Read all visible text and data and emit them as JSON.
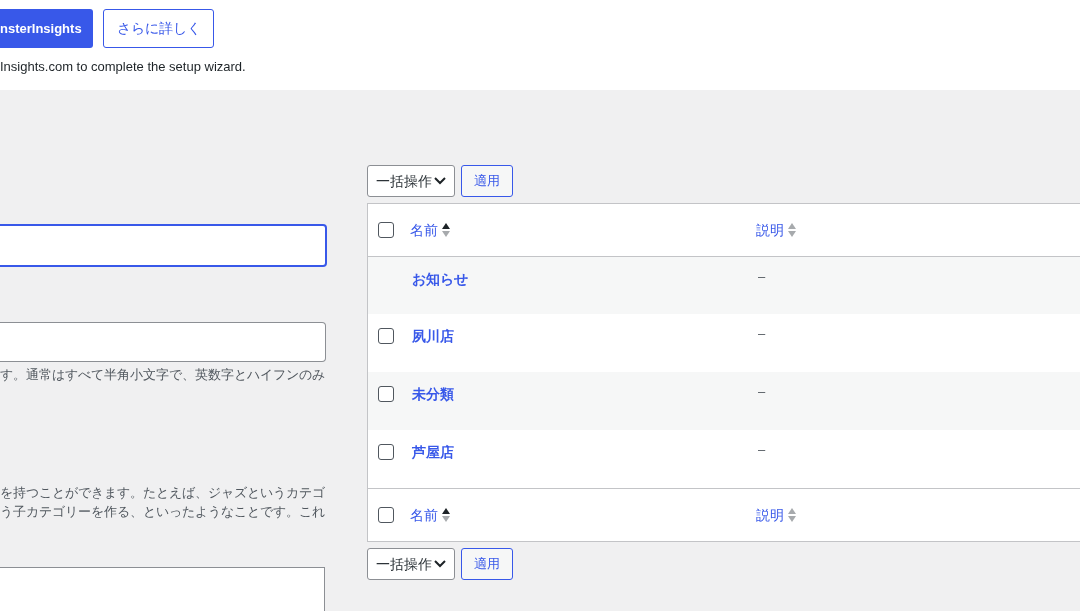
{
  "notice": {
    "primary_button": "nsterInsights",
    "secondary_button": "さらに詳しく",
    "text": "Insights.com to complete the setup wizard."
  },
  "form": {
    "slug_help": "す。通常はすべて半角小文字で、英数字とハイフンのみ",
    "parent_help": [
      "を持つことができます。たとえば、ジャズというカテゴ",
      "う子カテゴリーを作る、といったようなことです。これ"
    ]
  },
  "bulk_top": {
    "action": "一括操作",
    "apply": "適用"
  },
  "table": {
    "columns": [
      "名前",
      "説明"
    ],
    "header_checked": false,
    "rows": [
      {
        "name": "お知らせ",
        "description": "–",
        "has_checkbox": false
      },
      {
        "name": "夙川店",
        "description": "–",
        "has_checkbox": true,
        "checked": false
      },
      {
        "name": "未分類",
        "description": "–",
        "has_checkbox": true,
        "checked": false
      },
      {
        "name": "芦屋店",
        "description": "–",
        "has_checkbox": true,
        "checked": false
      }
    ],
    "footer_columns": [
      "名前",
      "説明"
    ],
    "footer_checked": false
  },
  "bulk_bottom": {
    "action": "一括操作",
    "apply": "適用"
  }
}
